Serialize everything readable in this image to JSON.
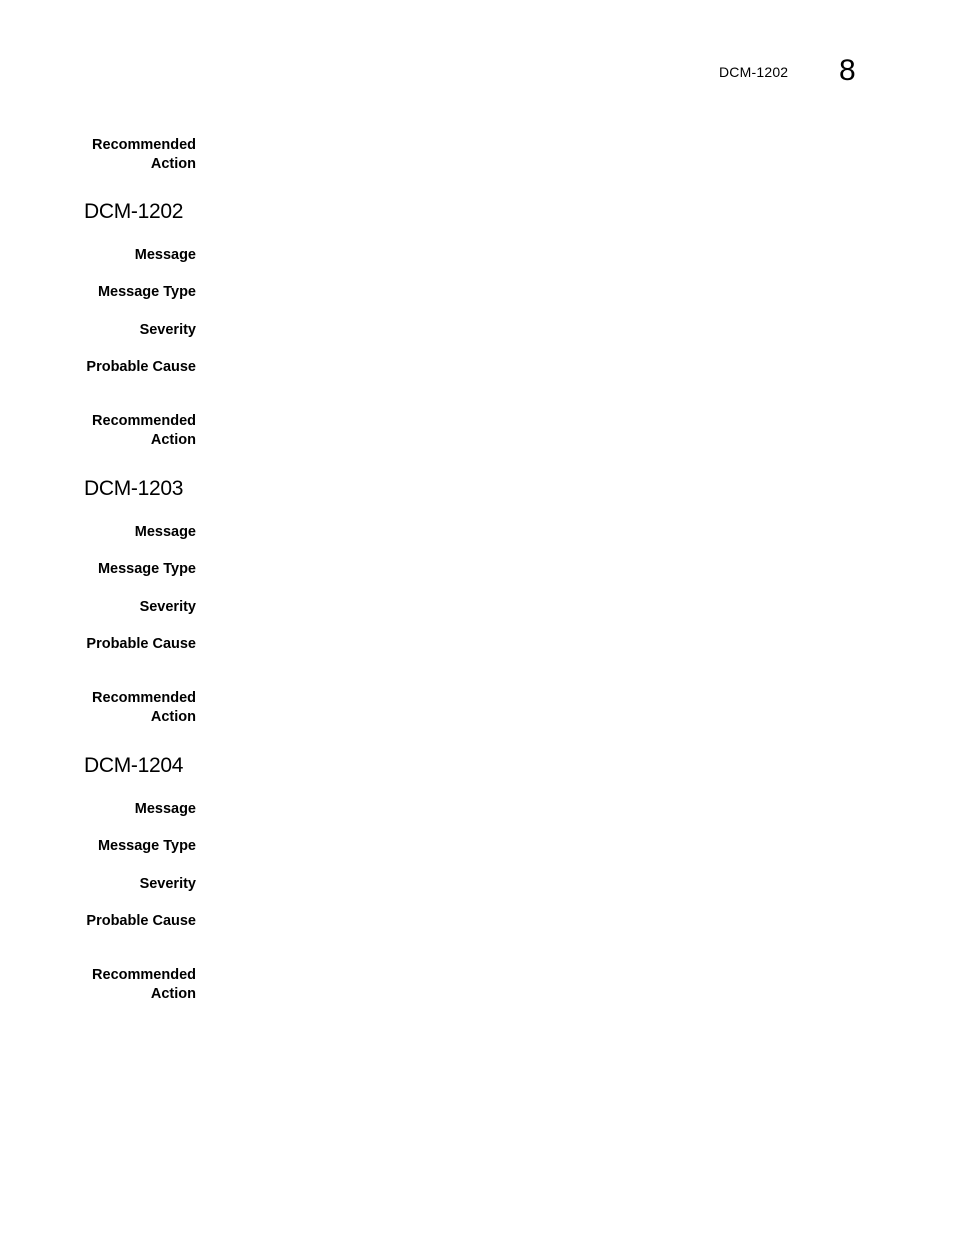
{
  "header": {
    "running_title": "DCM-1202",
    "chapter_number": "8"
  },
  "top_fragment": {
    "recommended_action_label_1": "Recommended",
    "recommended_action_label_2": "Action"
  },
  "entries": [
    {
      "id": "DCM-1202",
      "labels": {
        "message": "Message",
        "message_type": "Message Type",
        "severity": "Severity",
        "probable_cause": "Probable Cause",
        "recommended_action_1": "Recommended",
        "recommended_action_2": "Action"
      }
    },
    {
      "id": "DCM-1203",
      "labels": {
        "message": "Message",
        "message_type": "Message Type",
        "severity": "Severity",
        "probable_cause": "Probable Cause",
        "recommended_action_1": "Recommended",
        "recommended_action_2": "Action"
      }
    },
    {
      "id": "DCM-1204",
      "labels": {
        "message": "Message",
        "message_type": "Message Type",
        "severity": "Severity",
        "probable_cause": "Probable Cause",
        "recommended_action_1": "Recommended",
        "recommended_action_2": "Action"
      }
    }
  ]
}
